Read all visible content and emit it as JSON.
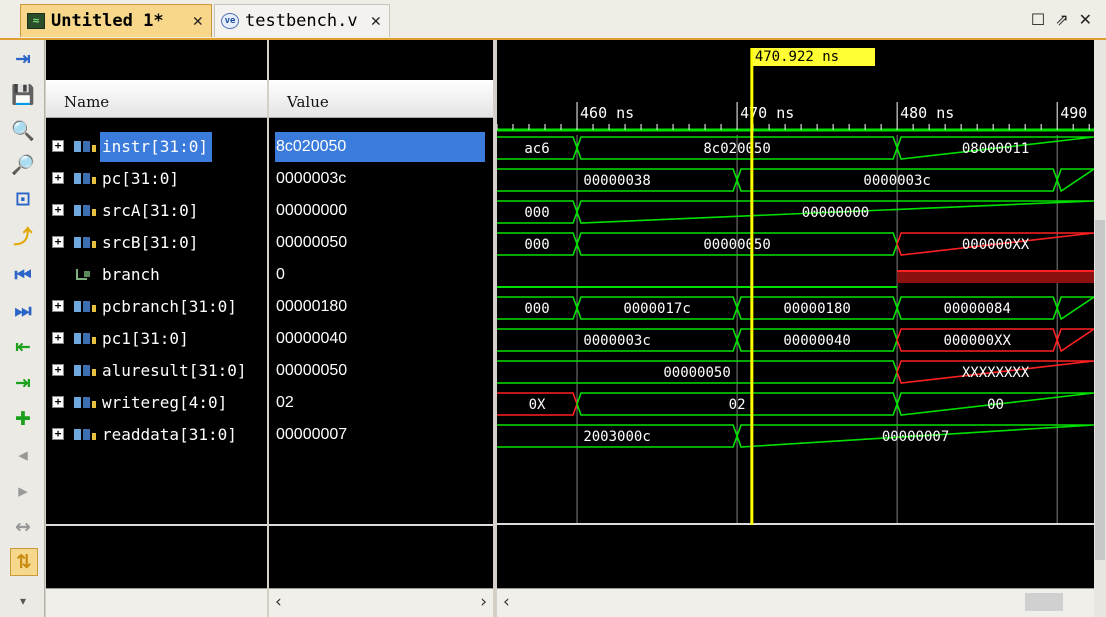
{
  "tabs": [
    {
      "label": "Untitled 1*",
      "active": true,
      "icon": "waveform-icon"
    },
    {
      "label": "testbench.v",
      "active": false,
      "icon": "verilog-file-icon"
    }
  ],
  "window_controls": [
    "restore",
    "float",
    "close"
  ],
  "toolbar": [
    "save",
    "zoom-in",
    "zoom-out",
    "zoom-fit",
    "go-to-cursor",
    "go-to-time-0",
    "go-to-last-time",
    "previous-transition",
    "next-transition",
    "add-marker",
    "previous-marker",
    "next-marker",
    "swap-cursors",
    "snap-to-transition"
  ],
  "headers": {
    "name": "Name",
    "value": "Value"
  },
  "signals": [
    {
      "name": "instr[31:0]",
      "value": "8c020050",
      "bus": true,
      "selected": true
    },
    {
      "name": "pc[31:0]",
      "value": "0000003c",
      "bus": true
    },
    {
      "name": "srcA[31:0]",
      "value": "00000000",
      "bus": true
    },
    {
      "name": "srcB[31:0]",
      "value": "00000050",
      "bus": true
    },
    {
      "name": "branch",
      "value": "0",
      "bus": false
    },
    {
      "name": "pcbranch[31:0]",
      "value": "00000180",
      "bus": true
    },
    {
      "name": "pc1[31:0]",
      "value": "00000040",
      "bus": true
    },
    {
      "name": "aluresult[31:0]",
      "value": "00000050",
      "bus": true
    },
    {
      "name": "writereg[4:0]",
      "value": "02",
      "bus": true
    },
    {
      "name": "readdata[31:0]",
      "value": "00000007",
      "bus": true
    }
  ],
  "cursor": {
    "time_label": "470.922 ns",
    "time_ns": 470.922
  },
  "timeline": {
    "labels": [
      "460 ns",
      "470 ns",
      "480 ns",
      "490"
    ],
    "ticks_ns": [
      460,
      470,
      480,
      490
    ],
    "view_start_ns": 455,
    "view_end_ns": 492.3
  },
  "waves": [
    {
      "segments": [
        {
          "t0": 455,
          "t1": 460,
          "label": "ac6",
          "x": false
        },
        {
          "t0": 460,
          "t1": 480,
          "label": "8c020050",
          "x": false
        },
        {
          "t0": 480,
          "t1": 492.3,
          "label": "08000011",
          "x": false
        }
      ]
    },
    {
      "segments": [
        {
          "t0": 455,
          "t1": 470,
          "label": "00000038",
          "x": false
        },
        {
          "t0": 470,
          "t1": 490,
          "label": "0000003c",
          "x": false
        },
        {
          "t0": 490,
          "t1": 492.3,
          "label": "",
          "x": false
        }
      ]
    },
    {
      "segments": [
        {
          "t0": 455,
          "t1": 460,
          "label": "000",
          "x": false
        },
        {
          "t0": 460,
          "t1": 492.3,
          "label": "00000000",
          "x": false
        }
      ]
    },
    {
      "segments": [
        {
          "t0": 455,
          "t1": 460,
          "label": "000",
          "x": false
        },
        {
          "t0": 460,
          "t1": 480,
          "label": "00000050",
          "x": false
        },
        {
          "t0": 480,
          "t1": 492.3,
          "label": "000000XX",
          "x": true
        }
      ]
    },
    {
      "segments": [
        {
          "t0": 455,
          "t1": 480,
          "label": "",
          "x": false,
          "bit": true
        },
        {
          "t0": 480,
          "t1": 492.3,
          "label": "",
          "x": true,
          "bit": true
        }
      ]
    },
    {
      "segments": [
        {
          "t0": 455,
          "t1": 460,
          "label": "000",
          "x": false
        },
        {
          "t0": 460,
          "t1": 470,
          "label": "0000017c",
          "x": false
        },
        {
          "t0": 470,
          "t1": 480,
          "label": "00000180",
          "x": false
        },
        {
          "t0": 480,
          "t1": 490,
          "label": "00000084",
          "x": false
        },
        {
          "t0": 490,
          "t1": 492.3,
          "label": "",
          "x": false
        }
      ]
    },
    {
      "segments": [
        {
          "t0": 455,
          "t1": 470,
          "label": "0000003c",
          "x": false
        },
        {
          "t0": 470,
          "t1": 480,
          "label": "00000040",
          "x": false
        },
        {
          "t0": 480,
          "t1": 490,
          "label": "000000XX",
          "x": true
        },
        {
          "t0": 490,
          "t1": 492.3,
          "label": "",
          "x": true
        }
      ]
    },
    {
      "segments": [
        {
          "t0": 455,
          "t1": 480,
          "label": "00000050",
          "x": false
        },
        {
          "t0": 480,
          "t1": 492.3,
          "label": "XXXXXXXX",
          "x": true
        }
      ]
    },
    {
      "segments": [
        {
          "t0": 455,
          "t1": 460,
          "label": "0X",
          "x": true
        },
        {
          "t0": 460,
          "t1": 480,
          "label": "02",
          "x": false
        },
        {
          "t0": 480,
          "t1": 492.3,
          "label": "00",
          "x": false
        }
      ]
    },
    {
      "segments": [
        {
          "t0": 455,
          "t1": 470,
          "label": "2003000c",
          "x": false
        },
        {
          "t0": 470,
          "t1": 492.3,
          "label": "00000007",
          "x": false
        }
      ]
    }
  ],
  "colors": {
    "wave": "#00e000",
    "xwave": "#ff2020",
    "cursor": "#ffff00",
    "selection": "#3a7bdc",
    "grid": "#808080"
  }
}
